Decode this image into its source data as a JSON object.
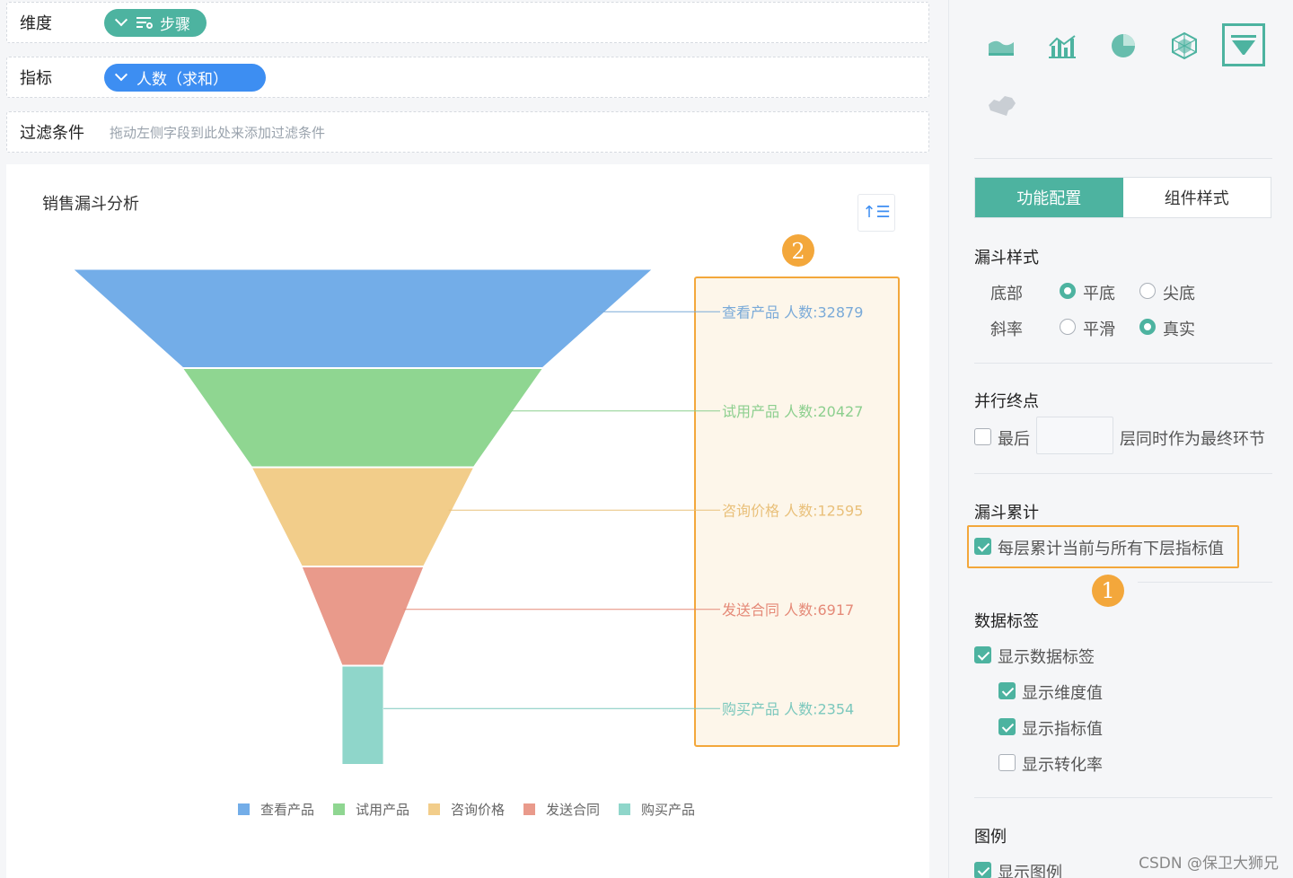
{
  "fields": {
    "dimension": {
      "label": "维度",
      "pill": "步骤"
    },
    "metric": {
      "label": "指标",
      "pill": "人数（求和）"
    },
    "filter": {
      "label": "过滤条件",
      "hint": "拖动左侧字段到此处来添加过滤条件"
    }
  },
  "chart": {
    "title": "销售漏斗分析",
    "sort_icon": "↑☰",
    "highlight_badge": "2"
  },
  "chart_data": {
    "type": "funnel",
    "title": "销售漏斗分析",
    "categories": [
      "查看产品",
      "试用产品",
      "咨询价格",
      "发送合同",
      "购买产品"
    ],
    "values": [
      32879,
      20427,
      12595,
      6917,
      2354
    ],
    "value_label": "人数",
    "labels": [
      "查看产品  人数:32879",
      "试用产品  人数:20427",
      "咨询价格  人数:12595",
      "发送合同  人数:6917",
      "购买产品  人数:2354"
    ],
    "colors": [
      "#73ade8",
      "#8fd691",
      "#f2cd8a",
      "#e99a8b",
      "#8fd6ca"
    ],
    "label_colors": [
      "#7aaad8",
      "#8ccf8e",
      "#e9c07a",
      "#e58a78",
      "#7cc8bd"
    ],
    "legend_placement": "bottom",
    "grid": false
  },
  "right_panel": {
    "chart_types": [
      {
        "name": "area-chart-icon",
        "active": false
      },
      {
        "name": "combo-chart-icon",
        "active": false
      },
      {
        "name": "pie-chart-icon",
        "active": false
      },
      {
        "name": "radar-chart-icon",
        "active": false
      },
      {
        "name": "funnel-chart-icon",
        "active": true
      },
      {
        "name": "map-chart-icon",
        "active": false
      }
    ],
    "tabs": [
      "功能配置",
      "组件样式"
    ],
    "funnel_style": {
      "title": "漏斗样式",
      "bottom_label": "底部",
      "bottom_options": [
        "平底",
        "尖底"
      ],
      "slope_label": "斜率",
      "slope_options": [
        "平滑",
        "真实"
      ]
    },
    "parallel_end": {
      "title": "并行终点",
      "last_label": "最后",
      "suffix": "层同时作为最终环节"
    },
    "cumulative": {
      "title": "漏斗累计",
      "option": "每层累计当前与所有下层指标值",
      "badge": "1"
    },
    "data_labels": {
      "title": "数据标签",
      "show": "显示数据标签",
      "show_dim": "显示维度值",
      "show_metric": "显示指标值",
      "show_rate": "显示转化率"
    },
    "legend": {
      "title": "图例",
      "show": "显示图例"
    }
  },
  "watermark": "CSDN @保卫大狮兄"
}
